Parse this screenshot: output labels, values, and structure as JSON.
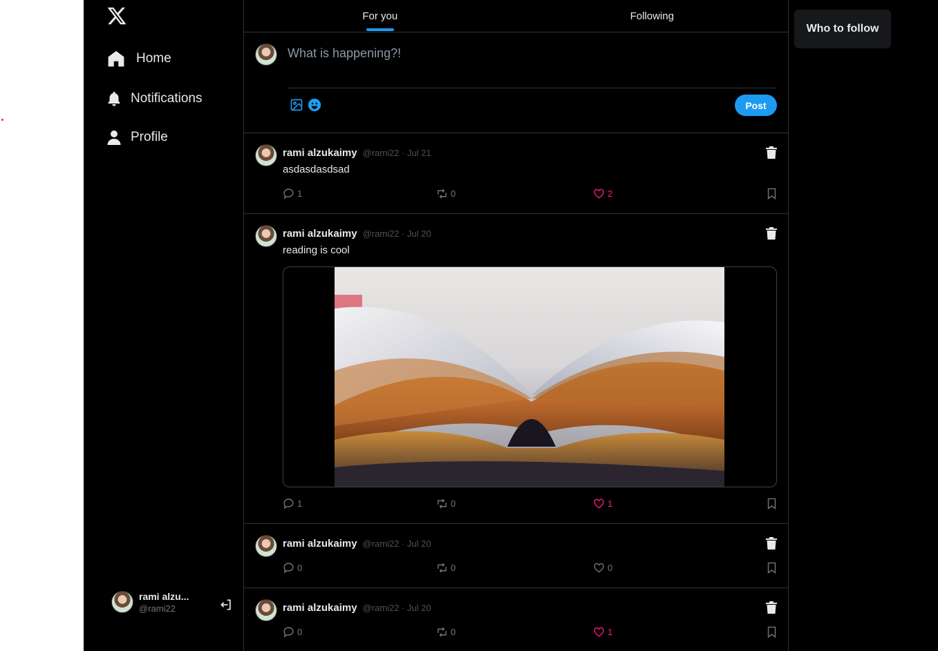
{
  "sidebar": {
    "logo_icon": "x-logo-icon",
    "nav": [
      {
        "label": "Home",
        "icon": "home-icon"
      },
      {
        "label": "Notifications",
        "icon": "bell-icon"
      },
      {
        "label": "Profile",
        "icon": "user-icon"
      }
    ],
    "account": {
      "name": "rami alzu...",
      "handle": "@rami22",
      "logout_icon": "logout-icon"
    }
  },
  "tabs": [
    {
      "label": "For you",
      "active": true
    },
    {
      "label": "Following",
      "active": false
    }
  ],
  "composer": {
    "placeholder": "What is happening?!",
    "post_label": "Post",
    "icons": [
      "image-icon",
      "emoji-icon"
    ]
  },
  "tweets": [
    {
      "name": "rami alzukaimy",
      "meta": "@rami22 · Jul 21",
      "text": "asdasdasdsad",
      "replies": "1",
      "retweets": "0",
      "likes": "2",
      "liked": true
    },
    {
      "name": "rami alzukaimy",
      "meta": "@rami22 · Jul 20",
      "text": "reading is cool",
      "replies": "1",
      "retweets": "0",
      "likes": "1",
      "liked": true,
      "media": "open-book-photo"
    },
    {
      "name": "rami alzukaimy",
      "meta": "@rami22 · Jul 20",
      "text": "",
      "replies": "0",
      "retweets": "0",
      "likes": "0",
      "liked": false
    },
    {
      "name": "rami alzukaimy",
      "meta": "@rami22 · Jul 20",
      "text": "",
      "replies": "0",
      "retweets": "0",
      "likes": "1",
      "liked": true
    }
  ],
  "right": {
    "who_to_follow": "Who to follow"
  },
  "colors": {
    "accent": "#1d9bf0",
    "like": "#f91880",
    "background": "#000000",
    "border": "#2f3336"
  }
}
